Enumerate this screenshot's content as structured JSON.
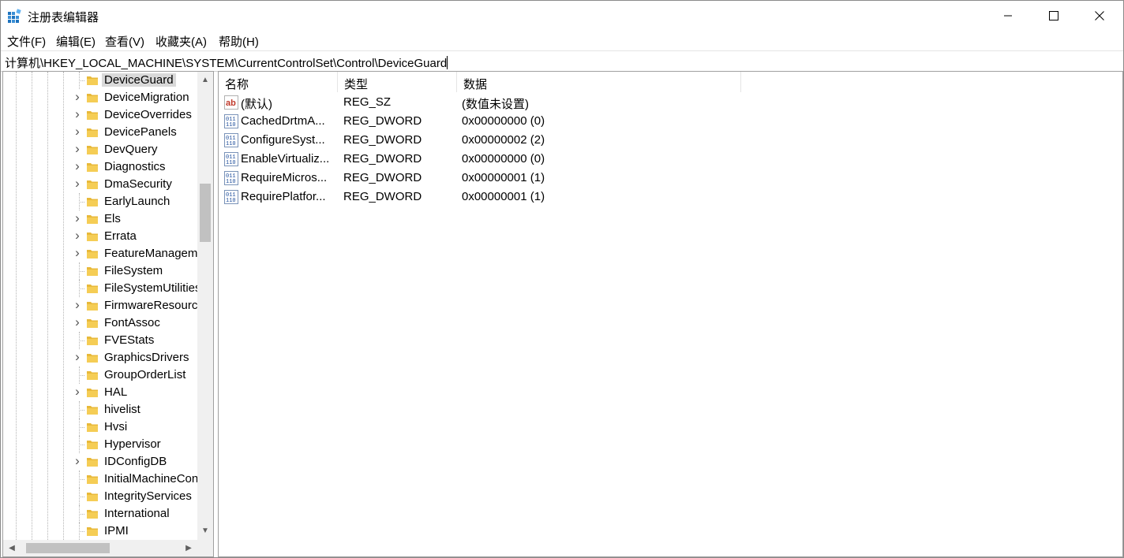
{
  "window": {
    "title": "注册表编辑器"
  },
  "menu": [
    "文件(F)",
    "编辑(E)",
    "查看(V)",
    "收藏夹(A)",
    "帮助(H)"
  ],
  "address": "计算机\\HKEY_LOCAL_MACHINE\\SYSTEM\\CurrentControlSet\\Control\\DeviceGuard",
  "tree": {
    "items": [
      {
        "label": "DeviceGuard",
        "expandable": false,
        "selected": true
      },
      {
        "label": "DeviceMigration",
        "expandable": true
      },
      {
        "label": "DeviceOverrides",
        "expandable": true
      },
      {
        "label": "DevicePanels",
        "expandable": true
      },
      {
        "label": "DevQuery",
        "expandable": true
      },
      {
        "label": "Diagnostics",
        "expandable": true
      },
      {
        "label": "DmaSecurity",
        "expandable": true
      },
      {
        "label": "EarlyLaunch",
        "expandable": false
      },
      {
        "label": "Els",
        "expandable": true
      },
      {
        "label": "Errata",
        "expandable": true
      },
      {
        "label": "FeatureManagement",
        "expandable": true
      },
      {
        "label": "FileSystem",
        "expandable": false
      },
      {
        "label": "FileSystemUtilities",
        "expandable": false
      },
      {
        "label": "FirmwareResources",
        "expandable": true
      },
      {
        "label": "FontAssoc",
        "expandable": true
      },
      {
        "label": "FVEStats",
        "expandable": false
      },
      {
        "label": "GraphicsDrivers",
        "expandable": true
      },
      {
        "label": "GroupOrderList",
        "expandable": false
      },
      {
        "label": "HAL",
        "expandable": true
      },
      {
        "label": "hivelist",
        "expandable": false
      },
      {
        "label": "Hvsi",
        "expandable": false
      },
      {
        "label": "Hypervisor",
        "expandable": false
      },
      {
        "label": "IDConfigDB",
        "expandable": true
      },
      {
        "label": "InitialMachineConfig",
        "expandable": false
      },
      {
        "label": "IntegrityServices",
        "expandable": false
      },
      {
        "label": "International",
        "expandable": false
      },
      {
        "label": "IPMI",
        "expandable": false
      }
    ]
  },
  "list": {
    "columns": {
      "name": "名称",
      "type": "类型",
      "data": "数据"
    },
    "rows": [
      {
        "name": "(默认)",
        "type": "REG_SZ",
        "data": "(数值未设置)",
        "icon": "string-value-icon"
      },
      {
        "name": "CachedDrtmA...",
        "type": "REG_DWORD",
        "data": "0x00000000 (0)",
        "icon": "binary-value-icon"
      },
      {
        "name": "ConfigureSyst...",
        "type": "REG_DWORD",
        "data": "0x00000002 (2)",
        "icon": "binary-value-icon"
      },
      {
        "name": "EnableVirtualiz...",
        "type": "REG_DWORD",
        "data": "0x00000000 (0)",
        "icon": "binary-value-icon"
      },
      {
        "name": "RequireMicros...",
        "type": "REG_DWORD",
        "data": "0x00000001 (1)",
        "icon": "binary-value-icon"
      },
      {
        "name": "RequirePlatfor...",
        "type": "REG_DWORD",
        "data": "0x00000001 (1)",
        "icon": "binary-value-icon"
      }
    ]
  },
  "colors": {
    "folder": "#e8b93a",
    "selection": "#d9d9d9",
    "border": "#a0a0a0"
  }
}
